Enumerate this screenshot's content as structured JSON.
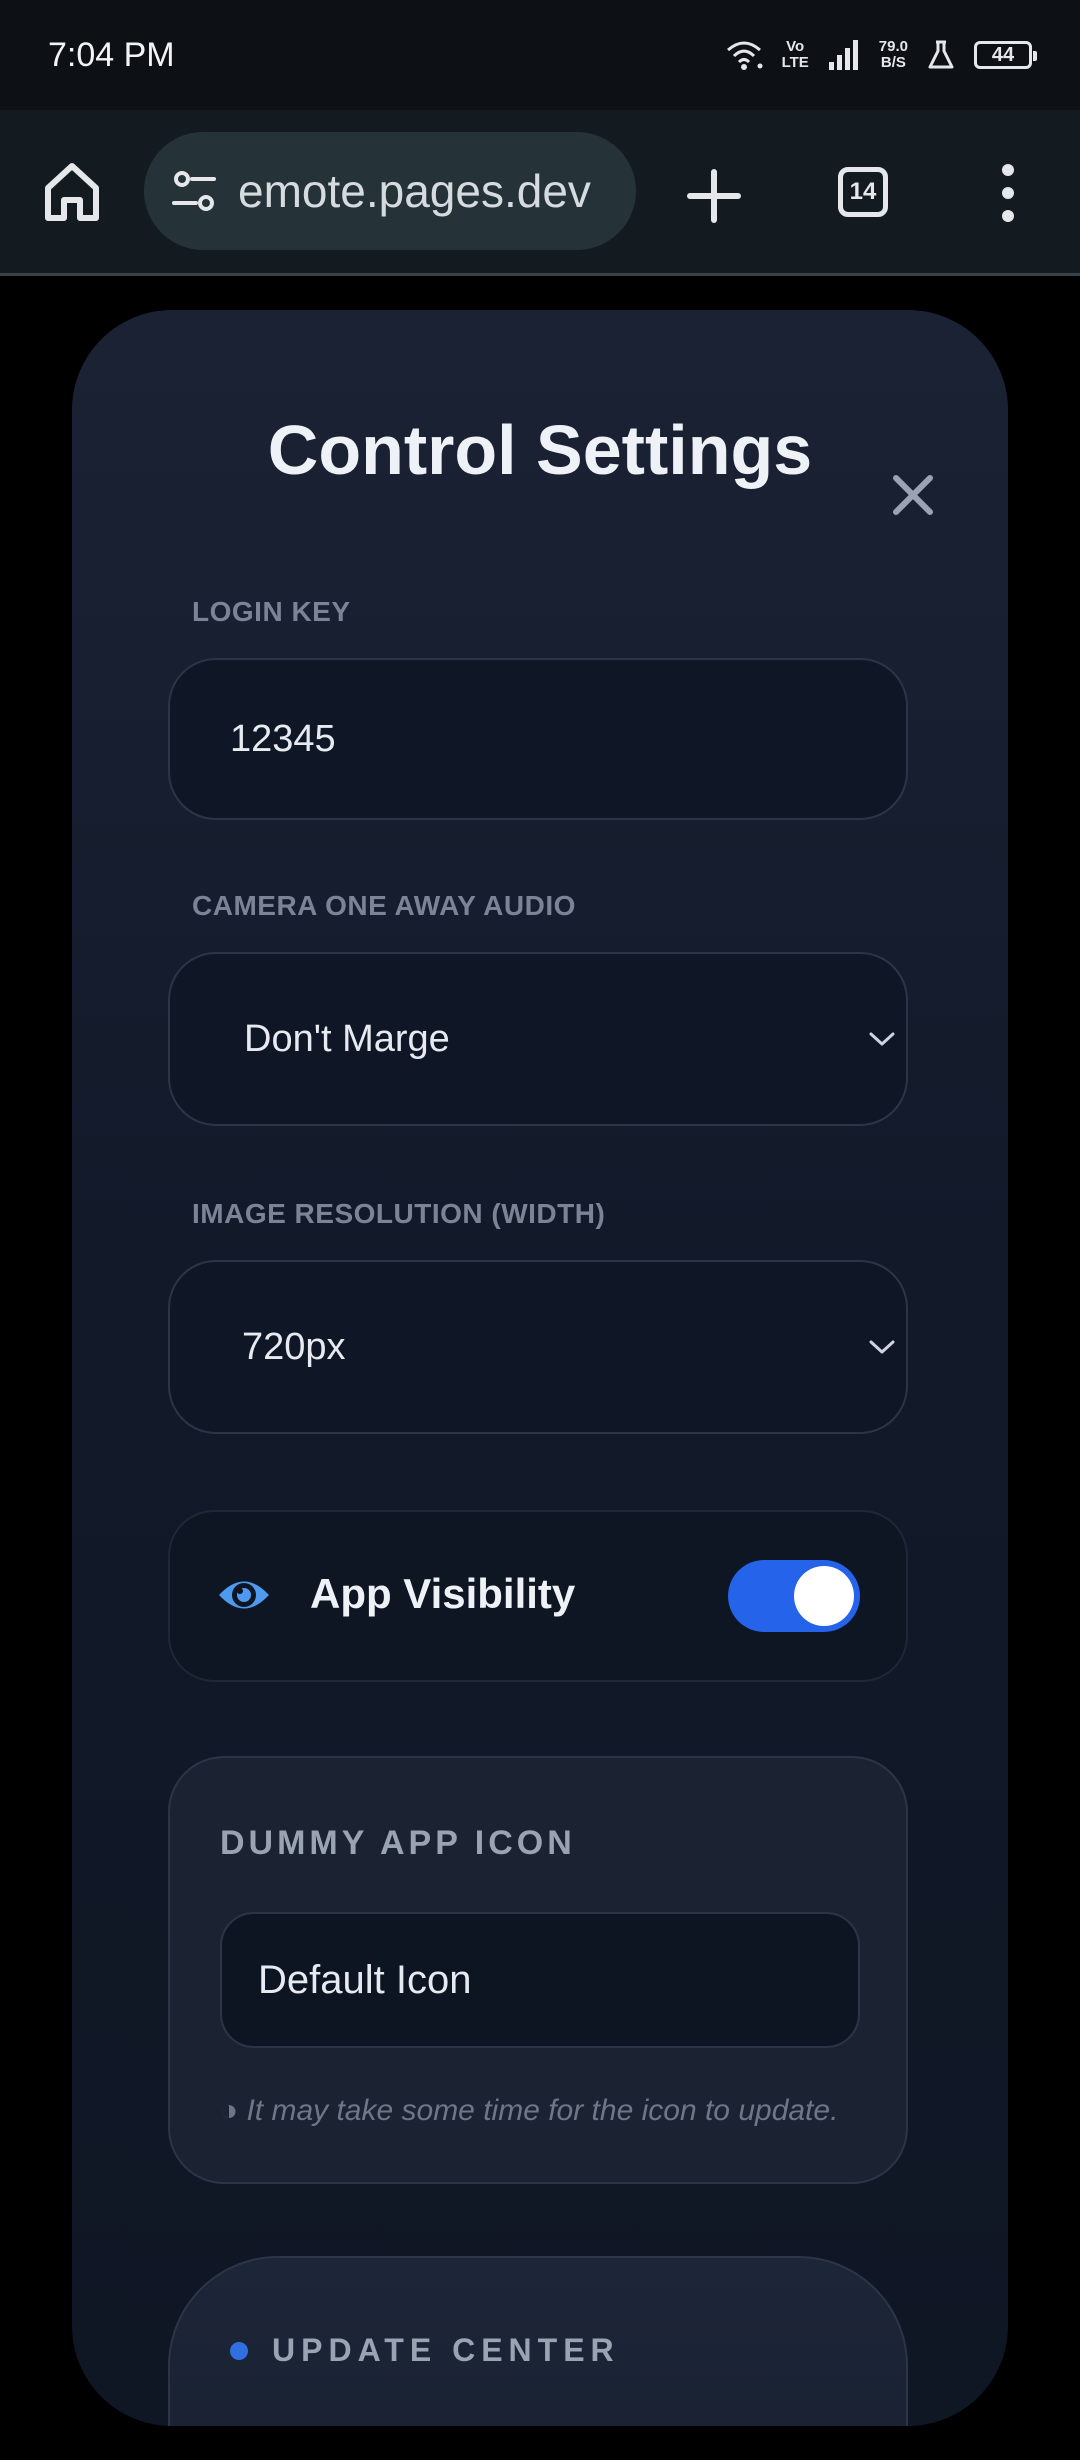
{
  "status_bar": {
    "time": "7:04 PM",
    "volte": "Vo\nLTE",
    "speed": "79.0\nB/S",
    "battery": "44"
  },
  "browser": {
    "url": "emote.pages.dev",
    "tab_count": "14"
  },
  "modal": {
    "title": "Control Settings",
    "login_key": {
      "label": "LOGIN KEY",
      "value": "12345"
    },
    "camera_audio": {
      "label": "CAMERA ONE AWAY AUDIO",
      "selected": "Don't Marge"
    },
    "image_resolution": {
      "label": "IMAGE RESOLUTION (WIDTH)",
      "selected": "720px"
    },
    "app_visibility": {
      "label": "App Visibility",
      "enabled": true
    },
    "dummy_icon": {
      "title": "DUMMY APP ICON",
      "value": "Default Icon",
      "note": "◑ It may take some time for the icon to update."
    },
    "update_center": {
      "title": "UPDATE CENTER"
    }
  },
  "colors": {
    "accent": "#2563eb",
    "modal_bg": "#141c2c",
    "text_muted": "#7b8496"
  }
}
